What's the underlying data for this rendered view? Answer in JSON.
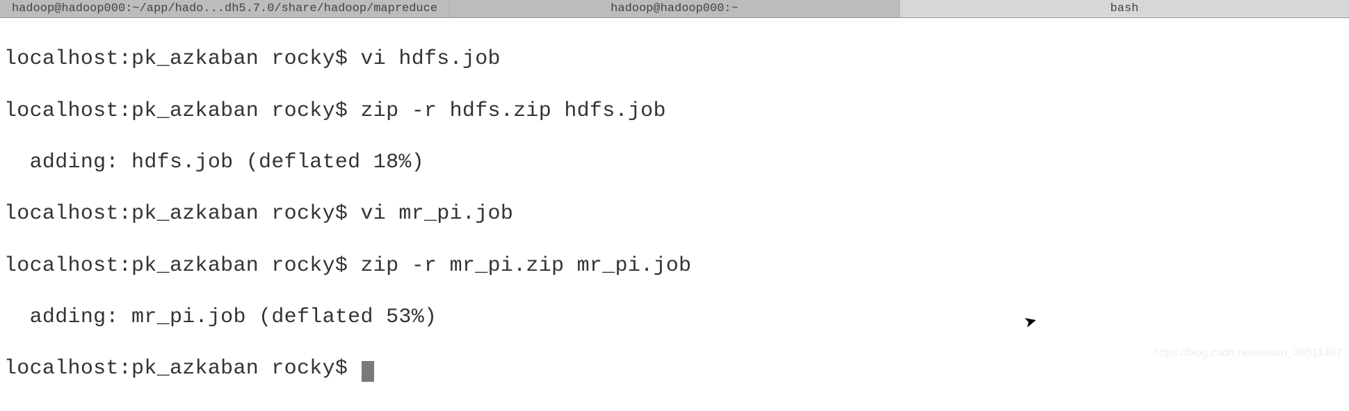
{
  "tabs": {
    "tab1": "hadoop@hadoop000:~/app/hado...dh5.7.0/share/hadoop/mapreduce",
    "tab2": "hadoop@hadoop000:~",
    "tab3": "bash"
  },
  "terminal": {
    "line1": "localhost:pk_azkaban rocky$ vi hdfs.job",
    "line2": "localhost:pk_azkaban rocky$ zip -r hdfs.zip hdfs.job",
    "line3": "  adding: hdfs.job (deflated 18%)",
    "line4": "localhost:pk_azkaban rocky$ vi mr_pi.job",
    "line5": "localhost:pk_azkaban rocky$ zip -r mr_pi.zip mr_pi.job",
    "line6": "  adding: mr_pi.job (deflated 53%)",
    "line7": "localhost:pk_azkaban rocky$ "
  },
  "watermark": "https://blog.csdn.net/weixin_38511497"
}
